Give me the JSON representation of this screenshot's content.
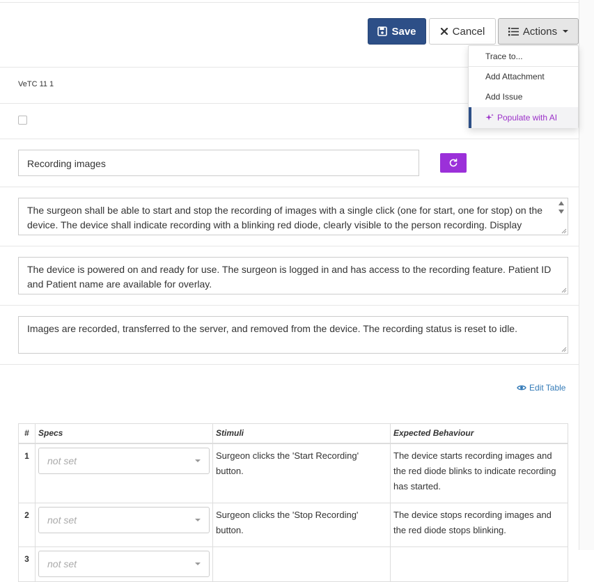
{
  "toolbar": {
    "save_label": "Save",
    "cancel_label": "Cancel",
    "actions_label": "Actions"
  },
  "actions_menu": {
    "items": [
      "Trace to...",
      "Add Attachment",
      "Add Issue"
    ],
    "ai_item": "Populate with AI"
  },
  "record": {
    "id": "VeTC 11 1",
    "title": "Recording images",
    "description": "The surgeon shall be able to start and stop the recording of images with a single click (one for start, one for stop) on the device. The device shall indicate recording with a blinking red diode, clearly visible to the person recording. Display Patient ID and Patient name visually overlaying on top (and not at the origin of the image. After",
    "preconditions": "The device is powered on and ready for use. The surgeon is logged in and has access to the recording feature. Patient ID and Patient name are available for overlay.",
    "postconditions": "Images are recorded, transferred to the server, and removed from the device. The recording status is reset to idle."
  },
  "steps_table": {
    "edit_label": "Edit Table",
    "headers": [
      "#",
      "Specs",
      "Stimuli",
      "Expected Behaviour"
    ],
    "spec_placeholder": "not set",
    "rows": [
      {
        "num": "1",
        "stimuli": "Surgeon clicks the 'Start Recording' button.",
        "expected": "The device starts recording images and the red diode blinks to indicate recording has started."
      },
      {
        "num": "2",
        "stimuli": "Surgeon clicks the 'Stop Recording' button.",
        "expected": "The device stops recording images and the red diode stops blinking."
      },
      {
        "num": "3",
        "stimuli": "",
        "expected": ""
      }
    ]
  },
  "colors": {
    "primary": "#2d4f87",
    "ai_accent": "#9b30d9",
    "link": "#337ab7"
  }
}
